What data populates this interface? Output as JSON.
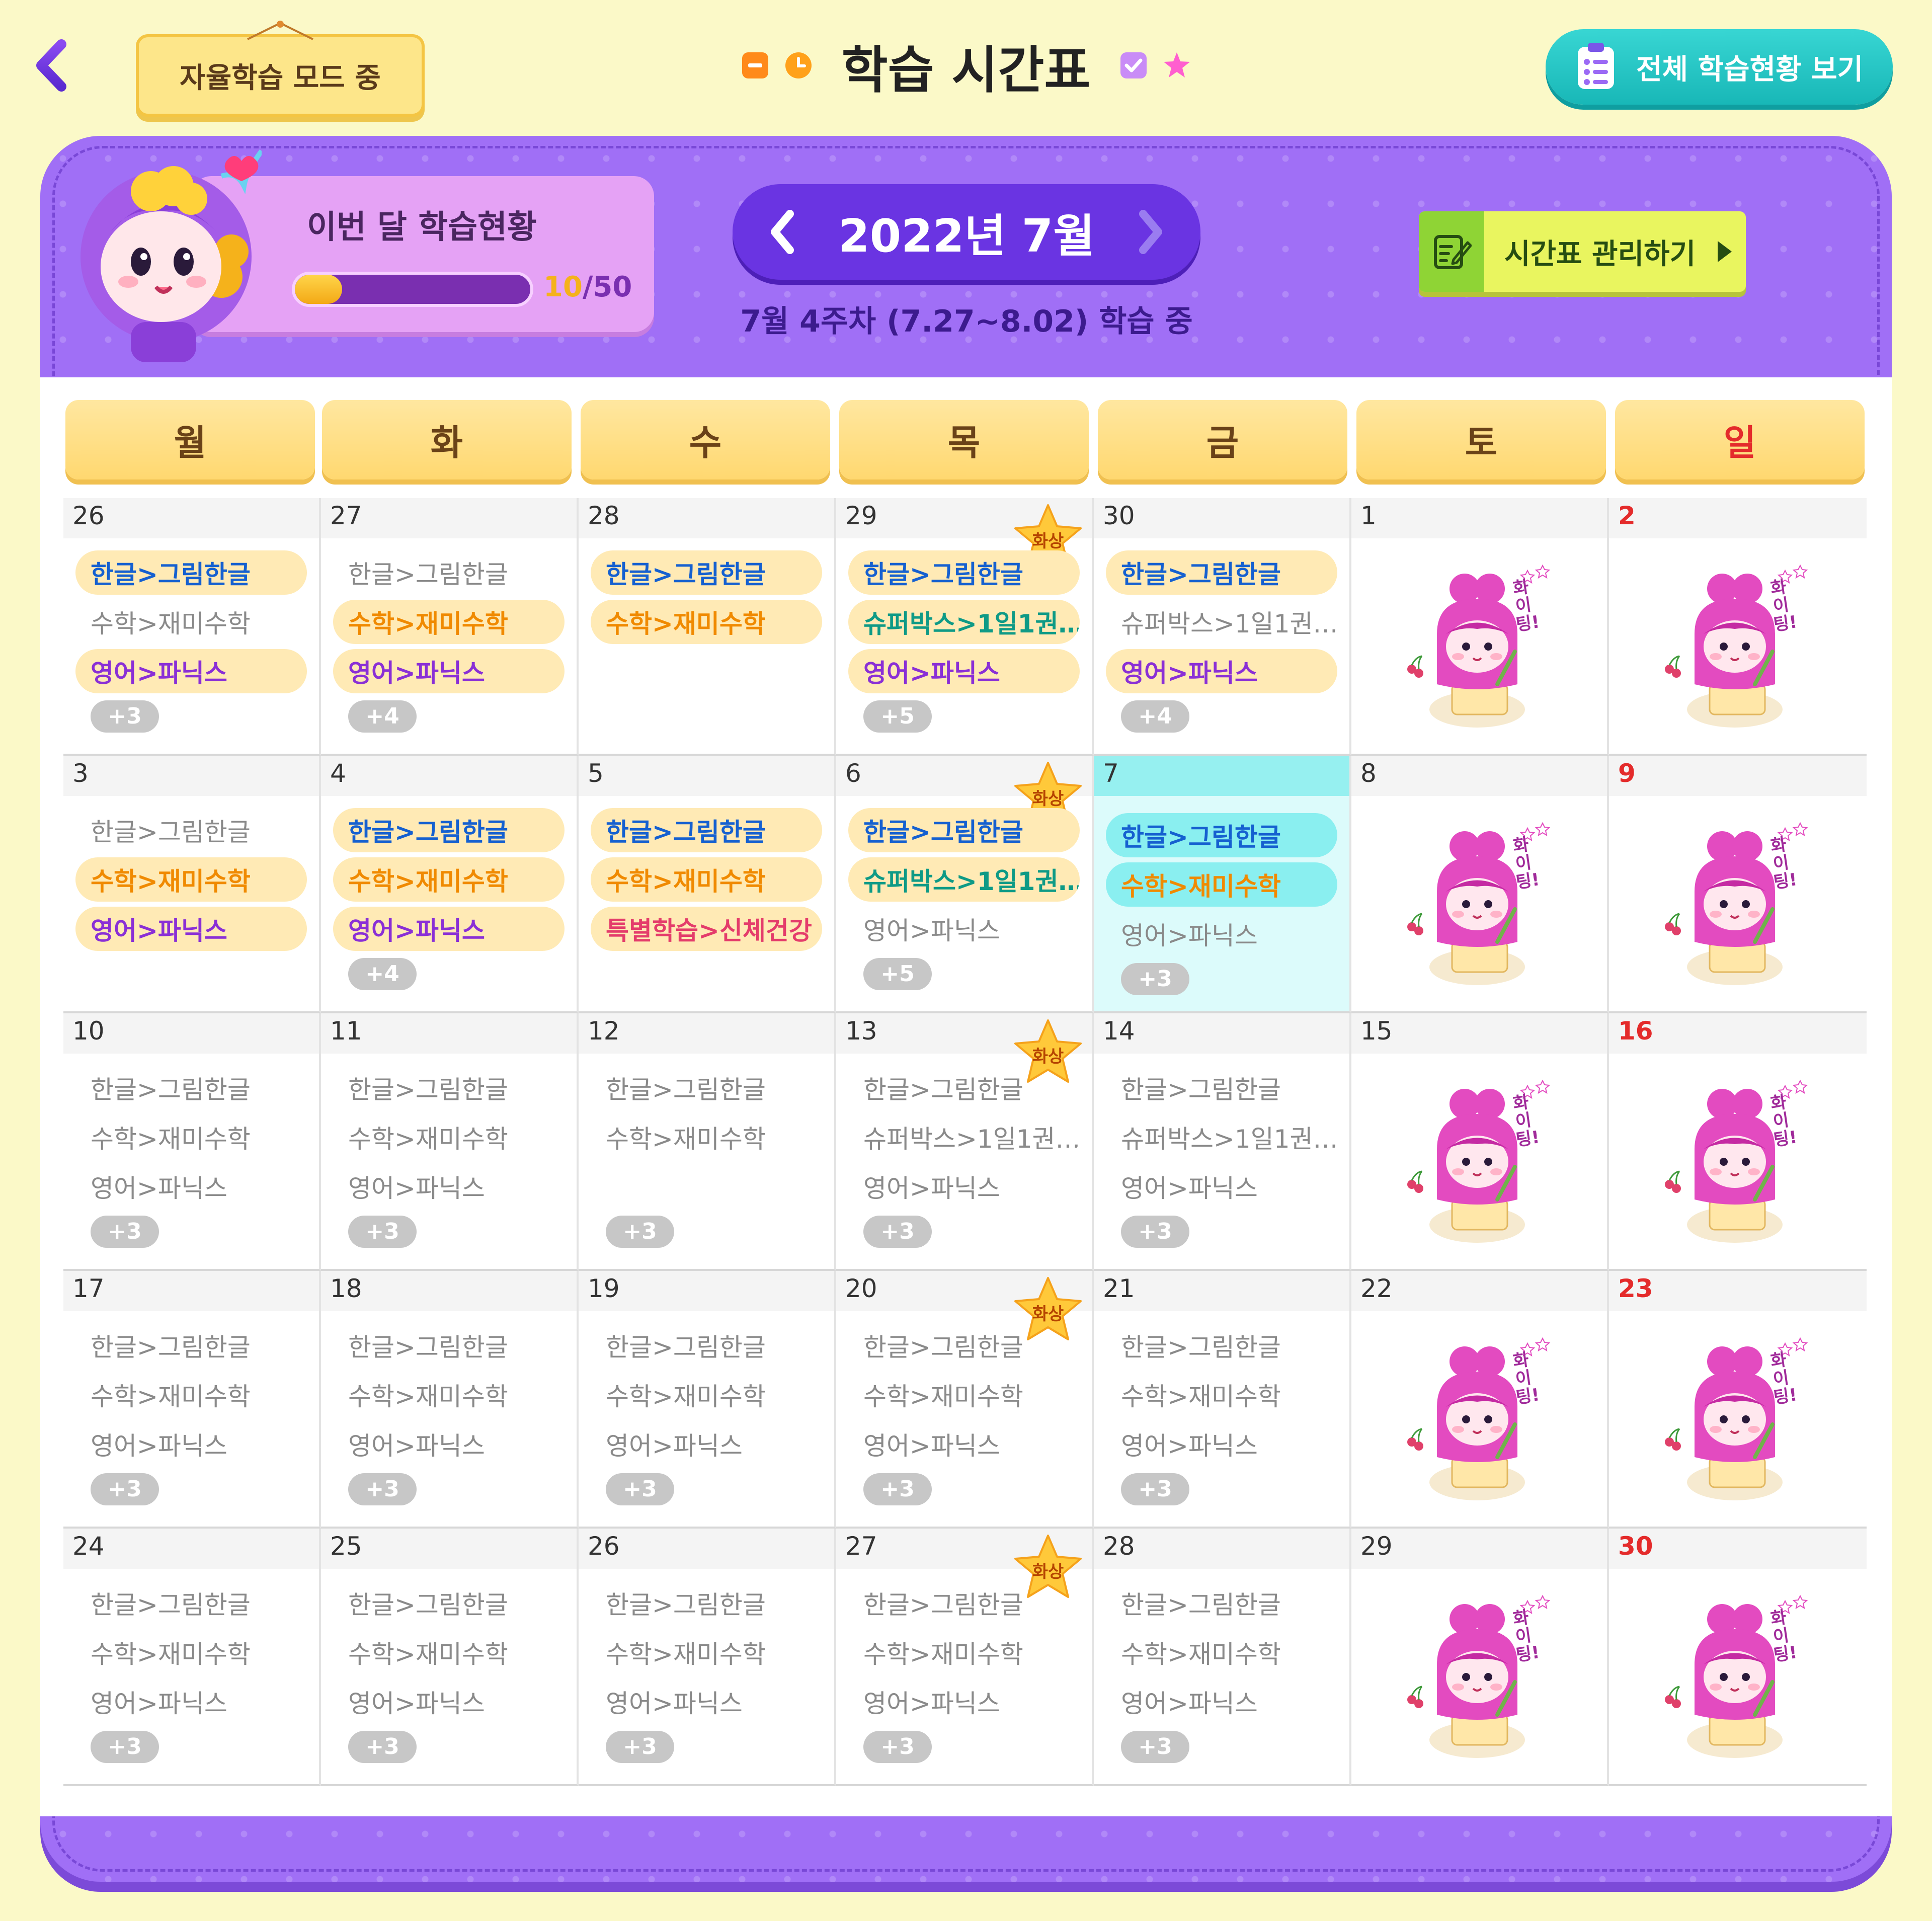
{
  "header": {
    "mode_tag": "자율학습 모드 중",
    "title": "학습 시간표",
    "overview_button": "전체 학습현황 보기"
  },
  "status": {
    "title": "이번 달 학습현황",
    "progress_current": "10",
    "progress_total": "/50",
    "progress_fraction": 0.2
  },
  "month": {
    "label": "2022년 7월",
    "week_info": "7월 4주차 (7.27~8.02) 학습 중"
  },
  "manage_button": "시간표 관리하기",
  "weekdays": [
    "월",
    "화",
    "수",
    "목",
    "금",
    "토",
    "일"
  ],
  "badge_label": "화상",
  "cheer_text": "화이팅!",
  "colors": {
    "background": "#fbf9c8",
    "panel": "#a06ff6",
    "accent_teal": "#18b7b7",
    "today": "#96f0f0",
    "sunday": "#e42b2b"
  },
  "weeks": [
    [
      {
        "date": "26",
        "items": [
          {
            "t": "한글>그림한글",
            "s": "hl",
            "c": "blue"
          },
          {
            "t": "수학>재미수학",
            "s": "plain"
          },
          {
            "t": "영어>파닉스",
            "s": "hl",
            "c": "purple"
          }
        ],
        "more": "+3"
      },
      {
        "date": "27",
        "items": [
          {
            "t": "한글>그림한글",
            "s": "plain"
          },
          {
            "t": "수학>재미수학",
            "s": "hl",
            "c": "orange"
          },
          {
            "t": "영어>파닉스",
            "s": "hl",
            "c": "purple"
          }
        ],
        "more": "+4"
      },
      {
        "date": "28",
        "items": [
          {
            "t": "한글>그림한글",
            "s": "hl",
            "c": "blue"
          },
          {
            "t": "수학>재미수학",
            "s": "hl",
            "c": "orange"
          }
        ]
      },
      {
        "date": "29",
        "badge": true,
        "items": [
          {
            "t": "한글>그림한글",
            "s": "hl",
            "c": "blue"
          },
          {
            "t": "슈퍼박스>1일1권…",
            "s": "hl",
            "c": "teal"
          },
          {
            "t": "영어>파닉스",
            "s": "hl",
            "c": "purple"
          }
        ],
        "more": "+5"
      },
      {
        "date": "30",
        "items": [
          {
            "t": "한글>그림한글",
            "s": "hl",
            "c": "blue"
          },
          {
            "t": "슈퍼박스>1일1권…",
            "s": "plain"
          },
          {
            "t": "영어>파닉스",
            "s": "hl",
            "c": "purple"
          }
        ],
        "more": "+4"
      },
      {
        "date": "1",
        "cheer": true
      },
      {
        "date": "2",
        "cheer": true,
        "sun": true
      }
    ],
    [
      {
        "date": "3",
        "items": [
          {
            "t": "한글>그림한글",
            "s": "plain"
          },
          {
            "t": "수학>재미수학",
            "s": "hl",
            "c": "orange"
          },
          {
            "t": "영어>파닉스",
            "s": "hl",
            "c": "purple"
          }
        ]
      },
      {
        "date": "4",
        "items": [
          {
            "t": "한글>그림한글",
            "s": "hl",
            "c": "blue"
          },
          {
            "t": "수학>재미수학",
            "s": "hl",
            "c": "orange"
          },
          {
            "t": "영어>파닉스",
            "s": "hl",
            "c": "purple"
          }
        ],
        "more": "+4"
      },
      {
        "date": "5",
        "items": [
          {
            "t": "한글>그림한글",
            "s": "hl",
            "c": "blue"
          },
          {
            "t": "수학>재미수학",
            "s": "hl",
            "c": "orange"
          },
          {
            "t": "특별학습>신체건강",
            "s": "hl",
            "c": "pink"
          }
        ]
      },
      {
        "date": "6",
        "badge": true,
        "items": [
          {
            "t": "한글>그림한글",
            "s": "hl",
            "c": "blue"
          },
          {
            "t": "슈퍼박스>1일1권…",
            "s": "hl",
            "c": "teal"
          },
          {
            "t": "영어>파닉스",
            "s": "plain"
          }
        ],
        "more": "+5"
      },
      {
        "date": "7",
        "today": true,
        "items": [
          {
            "t": "한글>그림한글",
            "s": "hl-today",
            "c": "blue"
          },
          {
            "t": "수학>재미수학",
            "s": "hl-today",
            "c": "orange"
          },
          {
            "t": "영어>파닉스",
            "s": "plain"
          }
        ],
        "more": "+3"
      },
      {
        "date": "8",
        "cheer": true
      },
      {
        "date": "9",
        "cheer": true,
        "sun": true
      }
    ],
    [
      {
        "date": "10",
        "items": [
          {
            "t": "한글>그림한글",
            "s": "plain"
          },
          {
            "t": "수학>재미수학",
            "s": "plain"
          },
          {
            "t": "영어>파닉스",
            "s": "plain"
          }
        ],
        "more": "+3"
      },
      {
        "date": "11",
        "items": [
          {
            "t": "한글>그림한글",
            "s": "plain"
          },
          {
            "t": "수학>재미수학",
            "s": "plain"
          },
          {
            "t": "영어>파닉스",
            "s": "plain"
          }
        ],
        "more": "+3"
      },
      {
        "date": "12",
        "items": [
          {
            "t": "한글>그림한글",
            "s": "plain"
          },
          {
            "t": "수학>재미수학",
            "s": "plain"
          }
        ],
        "more": "+3",
        "more_row": 3
      },
      {
        "date": "13",
        "badge": true,
        "items": [
          {
            "t": "한글>그림한글",
            "s": "plain"
          },
          {
            "t": "슈퍼박스>1일1권…",
            "s": "plain"
          },
          {
            "t": "영어>파닉스",
            "s": "plain"
          }
        ],
        "more": "+3"
      },
      {
        "date": "14",
        "items": [
          {
            "t": "한글>그림한글",
            "s": "plain"
          },
          {
            "t": "슈퍼박스>1일1권…",
            "s": "plain"
          },
          {
            "t": "영어>파닉스",
            "s": "plain"
          }
        ],
        "more": "+3"
      },
      {
        "date": "15",
        "cheer": true
      },
      {
        "date": "16",
        "cheer": true,
        "sun": true
      }
    ],
    [
      {
        "date": "17",
        "items": [
          {
            "t": "한글>그림한글",
            "s": "plain"
          },
          {
            "t": "수학>재미수학",
            "s": "plain"
          },
          {
            "t": "영어>파닉스",
            "s": "plain"
          }
        ],
        "more": "+3"
      },
      {
        "date": "18",
        "items": [
          {
            "t": "한글>그림한글",
            "s": "plain"
          },
          {
            "t": "수학>재미수학",
            "s": "plain"
          },
          {
            "t": "영어>파닉스",
            "s": "plain"
          }
        ],
        "more": "+3"
      },
      {
        "date": "19",
        "items": [
          {
            "t": "한글>그림한글",
            "s": "plain"
          },
          {
            "t": "수학>재미수학",
            "s": "plain"
          },
          {
            "t": "영어>파닉스",
            "s": "plain"
          }
        ],
        "more": "+3"
      },
      {
        "date": "20",
        "badge": true,
        "items": [
          {
            "t": "한글>그림한글",
            "s": "plain"
          },
          {
            "t": "수학>재미수학",
            "s": "plain"
          },
          {
            "t": "영어>파닉스",
            "s": "plain"
          }
        ],
        "more": "+3"
      },
      {
        "date": "21",
        "items": [
          {
            "t": "한글>그림한글",
            "s": "plain"
          },
          {
            "t": "수학>재미수학",
            "s": "plain"
          },
          {
            "t": "영어>파닉스",
            "s": "plain"
          }
        ],
        "more": "+3"
      },
      {
        "date": "22",
        "cheer": true
      },
      {
        "date": "23",
        "cheer": true,
        "sun": true
      }
    ],
    [
      {
        "date": "24",
        "items": [
          {
            "t": "한글>그림한글",
            "s": "plain"
          },
          {
            "t": "수학>재미수학",
            "s": "plain"
          },
          {
            "t": "영어>파닉스",
            "s": "plain"
          }
        ],
        "more": "+3"
      },
      {
        "date": "25",
        "items": [
          {
            "t": "한글>그림한글",
            "s": "plain"
          },
          {
            "t": "수학>재미수학",
            "s": "plain"
          },
          {
            "t": "영어>파닉스",
            "s": "plain"
          }
        ],
        "more": "+3"
      },
      {
        "date": "26",
        "items": [
          {
            "t": "한글>그림한글",
            "s": "plain"
          },
          {
            "t": "수학>재미수학",
            "s": "plain"
          },
          {
            "t": "영어>파닉스",
            "s": "plain"
          }
        ],
        "more": "+3"
      },
      {
        "date": "27",
        "badge": true,
        "items": [
          {
            "t": "한글>그림한글",
            "s": "plain"
          },
          {
            "t": "수학>재미수학",
            "s": "plain"
          },
          {
            "t": "영어>파닉스",
            "s": "plain"
          }
        ],
        "more": "+3"
      },
      {
        "date": "28",
        "items": [
          {
            "t": "한글>그림한글",
            "s": "plain"
          },
          {
            "t": "수학>재미수학",
            "s": "plain"
          },
          {
            "t": "영어>파닉스",
            "s": "plain"
          }
        ],
        "more": "+3"
      },
      {
        "date": "29",
        "cheer": true
      },
      {
        "date": "30",
        "cheer": true,
        "sun": true
      }
    ]
  ]
}
